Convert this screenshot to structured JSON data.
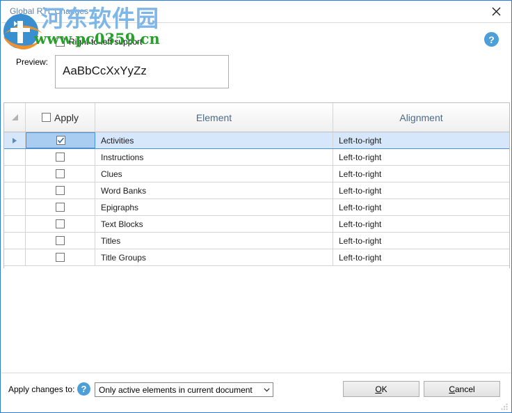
{
  "window": {
    "title": "Global RTL Changes",
    "close_icon": "close-icon",
    "border_color": "#2b7cd3"
  },
  "watermark": {
    "logo_icon": "site-logo-icon",
    "chinese_text": "河东软件园",
    "url_text": "www.pc0359.cn",
    "chinese_color": "#7fb6e8",
    "url_color": "#27a12c"
  },
  "help": {
    "top_icon": "help-icon",
    "bottom_icon": "help-icon",
    "glyph": "?"
  },
  "options": {
    "rtl_support_label": "Right-to-left support",
    "rtl_support_checked": false,
    "preview_label": "Preview:",
    "preview_text": "AaBbCcXxYyZz"
  },
  "grid": {
    "headers": {
      "selector": "",
      "apply": "Apply",
      "element": "Element",
      "alignment": "Alignment"
    },
    "header_checkbox_checked": false,
    "select_all_icon": "select-all-triangle-icon",
    "row_indicator_icon": "row-arrow-icon",
    "rows": [
      {
        "apply": true,
        "element": "Activities",
        "alignment": "Left-to-right",
        "selected": true
      },
      {
        "apply": false,
        "element": "Instructions",
        "alignment": "Left-to-right",
        "selected": false
      },
      {
        "apply": false,
        "element": "Clues",
        "alignment": "Left-to-right",
        "selected": false
      },
      {
        "apply": false,
        "element": "Word Banks",
        "alignment": "Left-to-right",
        "selected": false
      },
      {
        "apply": false,
        "element": "Epigraphs",
        "alignment": "Left-to-right",
        "selected": false
      },
      {
        "apply": false,
        "element": "Text Blocks",
        "alignment": "Left-to-right",
        "selected": false
      },
      {
        "apply": false,
        "element": "Titles",
        "alignment": "Left-to-right",
        "selected": false
      },
      {
        "apply": false,
        "element": "Title Groups",
        "alignment": "Left-to-right",
        "selected": false
      }
    ]
  },
  "footer": {
    "apply_changes_label": "Apply changes to:",
    "apply_changes_value": "Only active elements in current document",
    "dropdown_icon": "chevron-down-icon",
    "ok_mnemonic": "O",
    "ok_rest": "K",
    "cancel_mnemonic": "C",
    "cancel_rest": "ancel",
    "resize_grip_icon": "resize-grip-icon"
  }
}
